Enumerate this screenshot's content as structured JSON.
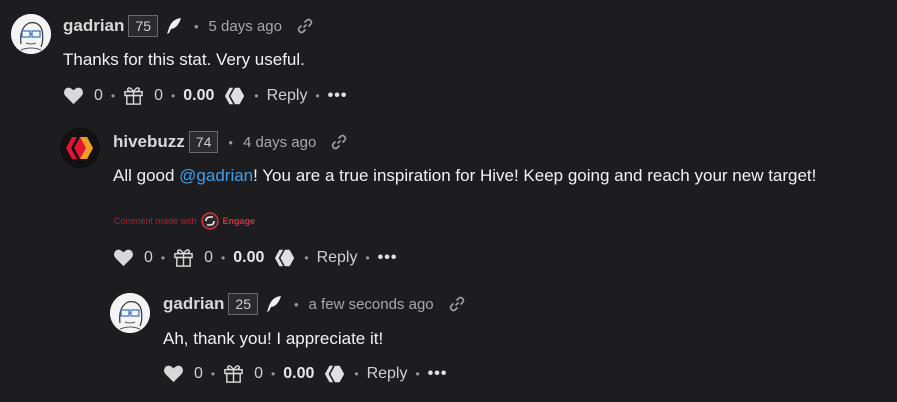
{
  "comments": [
    {
      "author": "gadrian",
      "reputation": "75",
      "time": "5 days ago",
      "body": "Thanks for this stat. Very useful.",
      "votes": "0",
      "gifts": "0",
      "payout": "0.00",
      "reply_label": "Reply",
      "more_label": "•••"
    },
    {
      "author": "hivebuzz",
      "reputation": "74",
      "time": "4 days ago",
      "body_prefix": "All good ",
      "mention": "@gadrian",
      "body_suffix": "! You are a true inspiration for Hive! Keep going and reach your new target!",
      "engage_prefix": "Comment made with",
      "engage_name": "Engage",
      "votes": "0",
      "gifts": "0",
      "payout": "0.00",
      "reply_label": "Reply",
      "more_label": "•••"
    },
    {
      "author": "gadrian",
      "reputation": "25",
      "time": "a few seconds ago",
      "body": "Ah, thank you! I appreciate it!",
      "votes": "0",
      "gifts": "0",
      "payout": "0.00",
      "reply_label": "Reply",
      "more_label": "•••"
    }
  ],
  "colors": {
    "background": "#1d1d1f",
    "mention": "#3f9ee8",
    "hivebuzz_red": "#e31337",
    "engage_red": "#d63040"
  },
  "icons": [
    "feather-icon",
    "link-icon",
    "heart-icon",
    "gift-icon",
    "hive-logo-icon",
    "more-icon",
    "engage-logo-icon"
  ]
}
